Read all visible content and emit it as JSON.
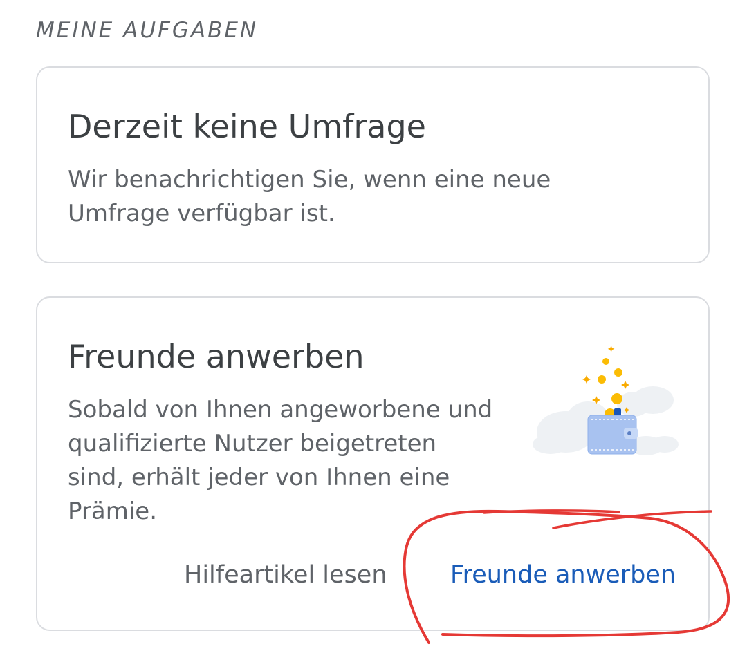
{
  "section": {
    "header": "MEINE AUFGABEN"
  },
  "survey_card": {
    "title": "Derzeit keine Umfrage",
    "body": "Wir benachrichtigen Sie, wenn eine neue Umfrage verfügbar ist."
  },
  "refer_card": {
    "title": "Freunde anwerben",
    "body": "Sobald von Ihnen angeworbene und qualifizierte Nutzer beigetreten sind, erhält jeder von Ihnen eine Prämie.",
    "illustration_icon": "wallet-coins-icon",
    "help_label": "Hilfeartikel lesen",
    "refer_label": "Freunde anwerben"
  },
  "colors": {
    "accent": "#1a5cb8",
    "annotation": "#e53935"
  }
}
